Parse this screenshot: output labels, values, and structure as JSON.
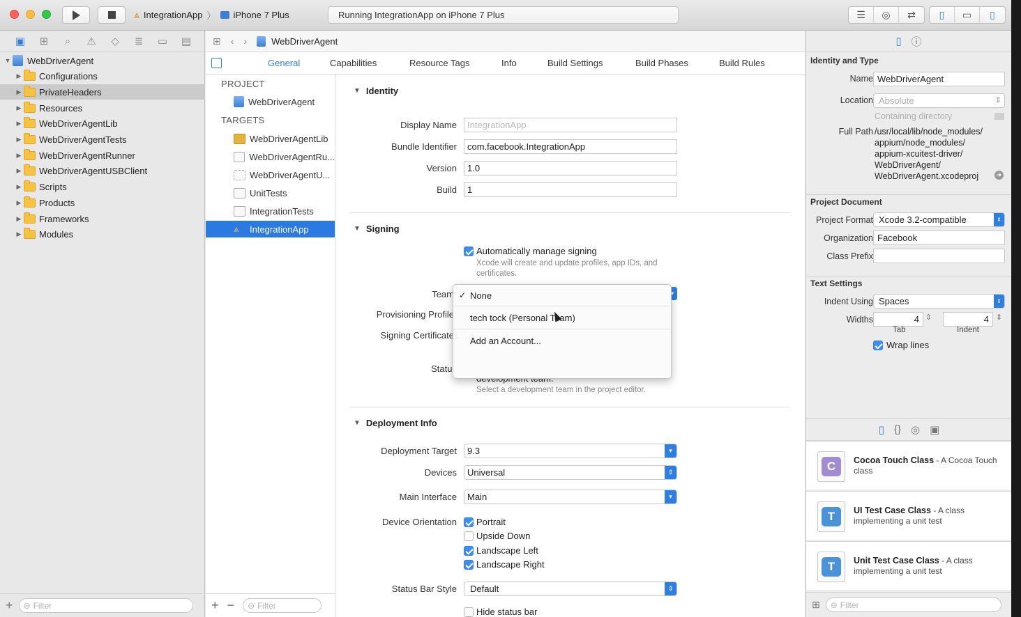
{
  "toolbar": {
    "scheme_name": "IntegrationApp",
    "scheme_separator": "〉",
    "device_name": "iPhone 7 Plus",
    "status_text": "Running IntegrationApp on iPhone 7 Plus",
    "icons": [
      "play-icon",
      "stop-icon",
      "editor-standard-icon",
      "editor-assistant-icon",
      "editor-version-icon",
      "navigator-toggle-icon",
      "debug-toggle-icon",
      "utilities-toggle-icon"
    ]
  },
  "navigator": {
    "items": [
      {
        "label": "WebDriverAgent",
        "kind": "project",
        "expanded": true
      },
      {
        "label": "Configurations",
        "kind": "folder"
      },
      {
        "label": "PrivateHeaders",
        "kind": "folder",
        "selected": true
      },
      {
        "label": "Resources",
        "kind": "folder"
      },
      {
        "label": "WebDriverAgentLib",
        "kind": "folder"
      },
      {
        "label": "WebDriverAgentTests",
        "kind": "folder"
      },
      {
        "label": "WebDriverAgentRunner",
        "kind": "folder"
      },
      {
        "label": "WebDriverAgentUSBClient",
        "kind": "folder"
      },
      {
        "label": "Scripts",
        "kind": "folder"
      },
      {
        "label": "Products",
        "kind": "folder"
      },
      {
        "label": "Frameworks",
        "kind": "folder"
      },
      {
        "label": "Modules",
        "kind": "folder"
      }
    ],
    "filter_placeholder": "Filter"
  },
  "editor": {
    "breadcrumb": "WebDriverAgent",
    "tabs": [
      "General",
      "Capabilities",
      "Resource Tags",
      "Info",
      "Build Settings",
      "Build Phases",
      "Build Rules"
    ],
    "active_tab": "General",
    "project_header": "PROJECT",
    "project_item": "WebDriverAgent",
    "targets_header": "TARGETS",
    "targets": [
      "WebDriverAgentLib",
      "WebDriverAgentRu...",
      "WebDriverAgentU...",
      "UnitTests",
      "IntegrationTests",
      "IntegrationApp"
    ],
    "selected_target": "IntegrationApp",
    "targets_filter_placeholder": "Filter",
    "identity": {
      "title": "Identity",
      "display_name_label": "Display Name",
      "display_name_placeholder": "IntegrationApp",
      "bundle_id_label": "Bundle Identifier",
      "bundle_id": "com.facebook.IntegrationApp",
      "version_label": "Version",
      "version": "1.0",
      "build_label": "Build",
      "build": "1"
    },
    "signing": {
      "title": "Signing",
      "auto_label": "Automatically manage signing",
      "auto_checked": true,
      "auto_hint": "Xcode will create and update profiles, app IDs, and certificates.",
      "team_label": "Team",
      "profile_label": "Provisioning Profile",
      "cert_label": "Signing Certificate",
      "status_label": "Status",
      "status_text": "Signing for \"IntegrationApp\" requires a development team.",
      "status_hint": "Select a development team in the project editor.",
      "team_menu": [
        "None",
        "tech tock (Personal Team)",
        "Add an Account..."
      ],
      "team_menu_checked": "None"
    },
    "deployment": {
      "title": "Deployment Info",
      "target_label": "Deployment Target",
      "target": "9.3",
      "devices_label": "Devices",
      "devices": "Universal",
      "main_interface_label": "Main Interface",
      "main_interface": "Main",
      "orientation_label": "Device Orientation",
      "orientations": [
        {
          "label": "Portrait",
          "checked": true
        },
        {
          "label": "Upside Down",
          "checked": false
        },
        {
          "label": "Landscape Left",
          "checked": true
        },
        {
          "label": "Landscape Right",
          "checked": true
        }
      ],
      "status_bar_label": "Status Bar Style",
      "status_bar": "Default",
      "hide_status_bar": "Hide status bar"
    }
  },
  "inspector": {
    "identity_title": "Identity and Type",
    "name_label": "Name",
    "name": "WebDriverAgent",
    "location_label": "Location",
    "location": "Absolute",
    "containing_dir": "Containing directory",
    "full_path_label": "Full Path",
    "full_path_lines": [
      "/usr/local/lib/node_modules/",
      "appium/node_modules/",
      "appium-xcuitest-driver/",
      "WebDriverAgent/",
      "WebDriverAgent.xcodeproj"
    ],
    "project_doc_title": "Project Document",
    "project_format_label": "Project Format",
    "project_format": "Xcode 3.2-compatible",
    "organization_label": "Organization",
    "organization": "Facebook",
    "class_prefix_label": "Class Prefix",
    "class_prefix": "",
    "text_settings_title": "Text Settings",
    "indent_using_label": "Indent Using",
    "indent_using": "Spaces",
    "widths_label": "Widths",
    "tab_width": "4",
    "indent_width": "4",
    "tab_caption": "Tab",
    "indent_caption": "Indent",
    "wrap_lines": "Wrap lines",
    "wrap_checked": true,
    "library": [
      {
        "title": "Cocoa Touch Class",
        "desc": " - A Cocoa Touch class",
        "glyph": "C",
        "color": "#a18bd1"
      },
      {
        "title": "UI Test Case Class",
        "desc": " - A class implementing a unit test",
        "glyph": "T",
        "color": "#4a93d9"
      },
      {
        "title": "Unit Test Case Class",
        "desc": " - A class implementing a unit test",
        "glyph": "T",
        "color": "#4a93d9"
      }
    ],
    "library_filter_placeholder": "Filter"
  }
}
